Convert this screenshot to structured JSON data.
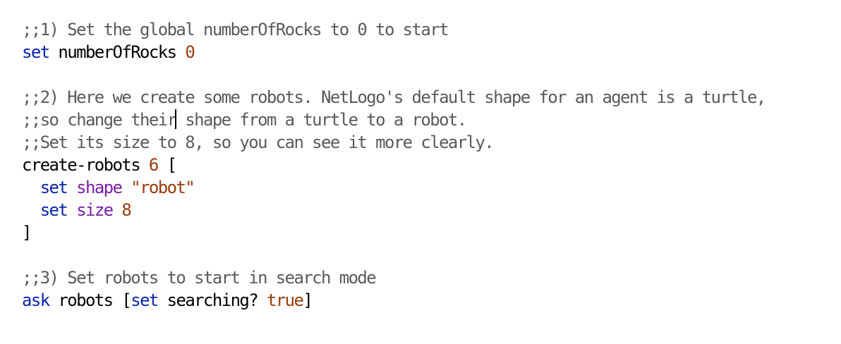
{
  "colors": {
    "background": "#ffffff",
    "comment": "#5a5a5a",
    "command": "#0a24a8",
    "reporter": "#7a1fa8",
    "constant": "#9c3b0c",
    "plain": "#000000"
  },
  "editor": {
    "lines": [
      {
        "tokens": [
          {
            "t": ";;1) Set the global numberOfRocks to 0 to start",
            "k": "comment"
          }
        ]
      },
      {
        "tokens": [
          {
            "t": "set",
            "k": "command"
          },
          {
            "t": " numberOfRocks ",
            "k": "plain"
          },
          {
            "t": "0",
            "k": "constant"
          }
        ]
      },
      {
        "tokens": []
      },
      {
        "tokens": [
          {
            "t": ";;2) Here we create some robots. NetLogo's default shape for an agent is a turtle,",
            "k": "comment"
          }
        ]
      },
      {
        "tokens": [
          {
            "t": ";;so change their",
            "k": "comment"
          },
          {
            "caret": true
          },
          {
            "t": " shape from a turtle to a robot.",
            "k": "comment"
          }
        ]
      },
      {
        "tokens": [
          {
            "t": ";;Set its size to 8, so you can see it more clearly.",
            "k": "comment"
          }
        ]
      },
      {
        "tokens": [
          {
            "t": "create-robots ",
            "k": "plain"
          },
          {
            "t": "6",
            "k": "constant"
          },
          {
            "t": " [",
            "k": "plain"
          }
        ]
      },
      {
        "tokens": [
          {
            "t": "  ",
            "k": "plain"
          },
          {
            "t": "set",
            "k": "command"
          },
          {
            "t": " ",
            "k": "plain"
          },
          {
            "t": "shape",
            "k": "reporter"
          },
          {
            "t": " ",
            "k": "plain"
          },
          {
            "t": "\"robot\"",
            "k": "constant"
          }
        ]
      },
      {
        "tokens": [
          {
            "t": "  ",
            "k": "plain"
          },
          {
            "t": "set",
            "k": "command"
          },
          {
            "t": " ",
            "k": "plain"
          },
          {
            "t": "size",
            "k": "reporter"
          },
          {
            "t": " ",
            "k": "plain"
          },
          {
            "t": "8",
            "k": "constant"
          }
        ]
      },
      {
        "tokens": [
          {
            "t": "]",
            "k": "plain"
          }
        ]
      },
      {
        "tokens": []
      },
      {
        "tokens": [
          {
            "t": ";;3) Set robots to start in search mode",
            "k": "comment"
          }
        ]
      },
      {
        "tokens": [
          {
            "t": "ask",
            "k": "command"
          },
          {
            "t": " robots [",
            "k": "plain"
          },
          {
            "t": "set",
            "k": "command"
          },
          {
            "t": " searching? ",
            "k": "plain"
          },
          {
            "t": "true",
            "k": "constant"
          },
          {
            "t": "]",
            "k": "plain"
          }
        ]
      }
    ]
  }
}
